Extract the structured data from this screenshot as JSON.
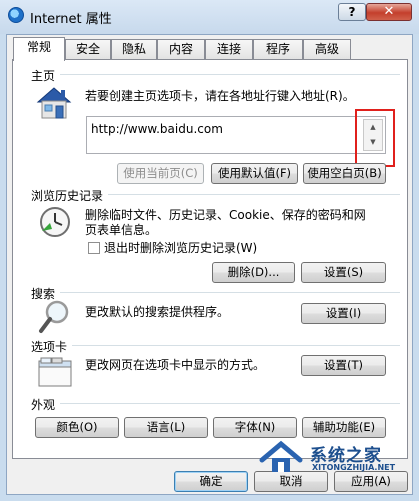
{
  "window": {
    "title": "Internet 属性",
    "help_label": "?",
    "close_label": "✕"
  },
  "tabs": [
    "常规",
    "安全",
    "隐私",
    "内容",
    "连接",
    "程序",
    "高级"
  ],
  "home": {
    "label": "主页",
    "description": "若要创建主页选项卡，请在各地址行键入地址(R)。",
    "url": "http://www.baidu.com",
    "btn_current": "使用当前页(C)",
    "btn_default": "使用默认值(F)",
    "btn_blank": "使用空白页(B)"
  },
  "history": {
    "label": "浏览历史记录",
    "description": "删除临时文件、历史记录、Cookie、保存的密码和网页表单信息。",
    "checkbox_label": "退出时删除浏览历史记录(W)",
    "btn_delete": "删除(D)...",
    "btn_settings": "设置(S)"
  },
  "search": {
    "label": "搜索",
    "description": "更改默认的搜索提供程序。",
    "btn_settings": "设置(I)"
  },
  "tabs_section": {
    "label": "选项卡",
    "description": "更改网页在选项卡中显示的方式。",
    "btn_settings": "设置(T)"
  },
  "appearance": {
    "label": "外观",
    "btn_colors": "颜色(O)",
    "btn_languages": "语言(L)",
    "btn_fonts": "字体(N)",
    "btn_accessibility": "辅助功能(E)"
  },
  "footer": {
    "ok": "确定",
    "cancel": "取消",
    "apply": "应用(A)"
  },
  "watermark": {
    "site_name": "系统之家",
    "site_url": "XITONGZHIJIA.NET"
  },
  "colors": {
    "highlight_box": "#e0201c",
    "accent": "#3c7fb1"
  }
}
